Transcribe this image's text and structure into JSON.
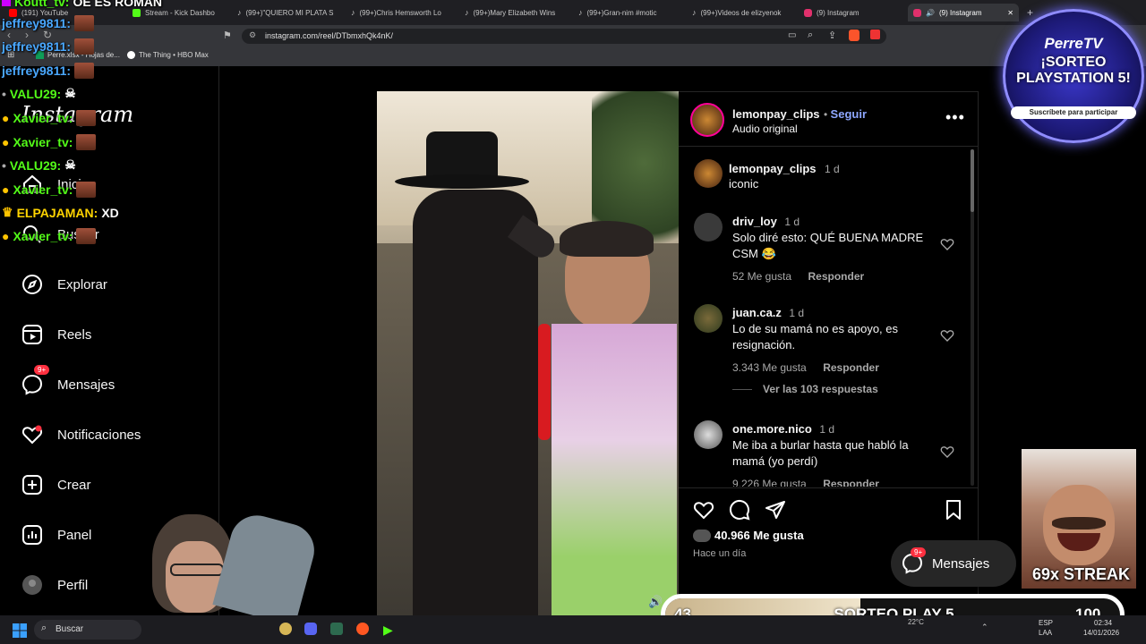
{
  "browser": {
    "tabs": [
      {
        "label": "(191) YouTube",
        "color": "#ff0000"
      },
      {
        "label": "Stream - Kick Dashbo",
        "color": "#53fc18"
      },
      {
        "label": "(99+)\"QUIERO MI PLATA S",
        "color": "#ffffff"
      },
      {
        "label": "(99+)Chris Hemsworth Lo",
        "color": "#ffffff"
      },
      {
        "label": "(99+)Mary Elizabeth Wins",
        "color": "#ffffff"
      },
      {
        "label": "(99+)Gran-nim #motic",
        "color": "#ffffff"
      },
      {
        "label": "(99+)Videos de elizyenok",
        "color": "#ffffff"
      },
      {
        "label": "(9) Instagram",
        "color": "#e1306c"
      },
      {
        "label": "(9) Instagram",
        "color": "#e1306c"
      }
    ],
    "url": "instagram.com/reel/DTbmxhQk4nK/",
    "bookmarks": [
      "Perre.xlsx - Hojas de...",
      "The Thing • HBO Max"
    ]
  },
  "sidebar": {
    "logo": "Instagram",
    "items": [
      {
        "label": "Inicio",
        "icon": "home-icon"
      },
      {
        "label": "Buscar",
        "icon": "search-icon"
      },
      {
        "label": "Explorar",
        "icon": "compass-icon"
      },
      {
        "label": "Reels",
        "icon": "reels-icon"
      },
      {
        "label": "Mensajes",
        "icon": "messenger-icon",
        "badge": "9+"
      },
      {
        "label": "Notificaciones",
        "icon": "heart-icon"
      },
      {
        "label": "Crear",
        "icon": "plus-icon"
      },
      {
        "label": "Panel",
        "icon": "chart-icon"
      },
      {
        "label": "Perfil",
        "icon": "avatar-icon"
      }
    ]
  },
  "post": {
    "author": "lemonpay_clips",
    "follow": "Seguir",
    "audio": "Audio original",
    "caption": {
      "user": "lemonpay_clips",
      "time": "1 d",
      "text": "iconic"
    },
    "comments": [
      {
        "user": "driv_loy",
        "time": "1 d",
        "text": "Solo diré esto: QUÉ BUENA MADRE CSM 😂",
        "likes": "52 Me gusta",
        "reply": "Responder"
      },
      {
        "user": "juan.ca.z",
        "time": "1 d",
        "text": "Lo de su mamá no es apoyo, es resignación.",
        "likes": "3.343 Me gusta",
        "reply": "Responder",
        "view_replies": "Ver las 103 respuestas"
      },
      {
        "user": "one.more.nico",
        "time": "1 d",
        "text": "Me iba a burlar hasta que habló la mamá (yo perdí)",
        "likes": "9.226 Me gusta",
        "reply": "Responder"
      }
    ],
    "likes": "40.966 Me gusta",
    "posted": "Hace un día"
  },
  "messages_button": {
    "label": "Mensajes",
    "badge": "9+"
  },
  "overlay": {
    "chat": [
      {
        "user": "Koutt_tv:",
        "text": "OE ES ROMAN",
        "color": "#53fc18"
      },
      {
        "user": "jeffrey9811:",
        "text": "",
        "color": "#4aa8ff"
      },
      {
        "user": "jeffrey9811:",
        "text": "",
        "color": "#4aa8ff"
      },
      {
        "user": "jeffrey9811:",
        "text": "",
        "color": "#4aa8ff"
      },
      {
        "user": "VALU29:",
        "text": "",
        "color": "#53fc18"
      },
      {
        "user": "Xavier_tv:",
        "text": "",
        "color": "#53fc18"
      },
      {
        "user": "Xavier_tv:",
        "text": "",
        "color": "#53fc18"
      },
      {
        "user": "VALU29:",
        "text": "",
        "color": "#53fc18"
      },
      {
        "user": "Xavier_tv:",
        "text": "",
        "color": "#53fc18"
      },
      {
        "user": "ELPAJAMAN:",
        "text": "XD",
        "color": "#ffd400"
      },
      {
        "user": "Xavier_tv:",
        "text": "",
        "color": "#53fc18"
      }
    ],
    "promo": {
      "brand": "PerreTV",
      "title": "¡SORTEO PLAYSTATION 5!",
      "subtitle": "Suscríbete para participar"
    },
    "streak": "69x STREAK",
    "progress": {
      "left": "43",
      "label": "SORTEO PLAY 5",
      "right": "100",
      "fraction": 0.43
    }
  },
  "taskbar": {
    "search": "Buscar",
    "weather": "22°C",
    "lang": "ESP",
    "lang2": "LAA",
    "time": "02:34",
    "date": "14/01/2026"
  }
}
